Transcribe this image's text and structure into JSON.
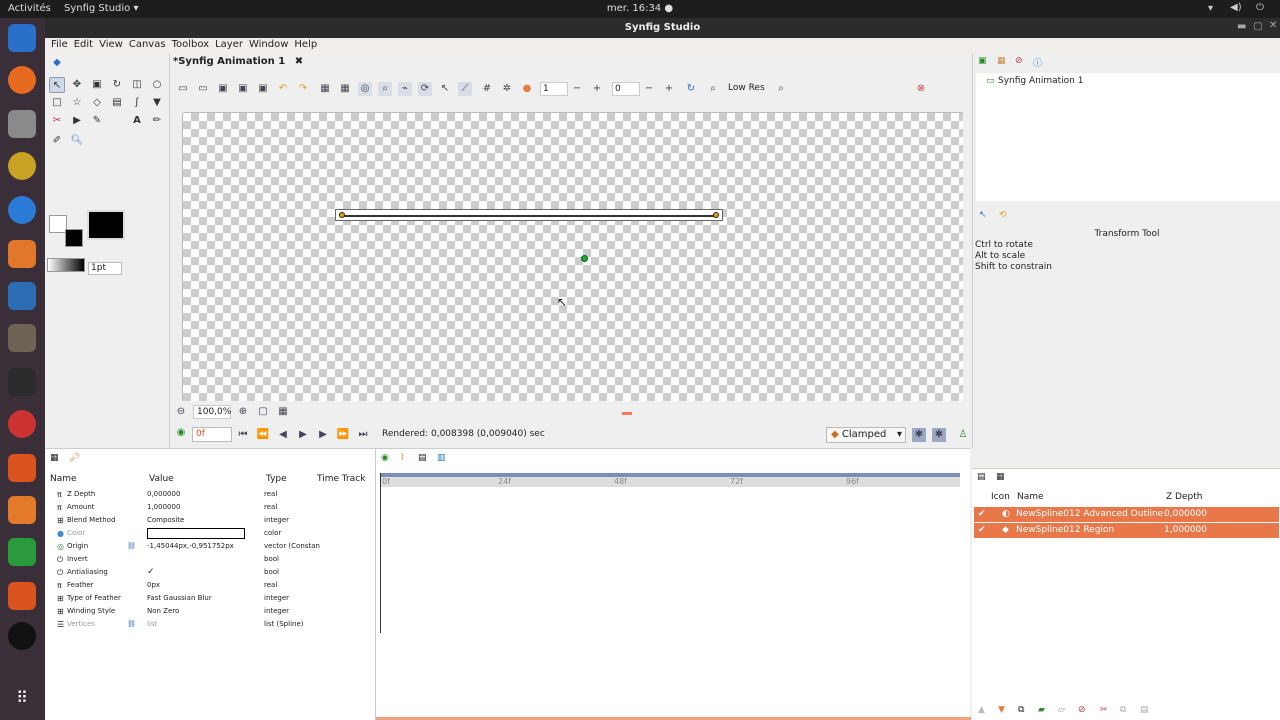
{
  "system": {
    "activities": "Activités",
    "app_menu": "Synfig Studio ▾",
    "clock": "mer. 16:34 ●"
  },
  "window": {
    "title": "Synfig Studio"
  },
  "menu": [
    "File",
    "Edit",
    "View",
    "Canvas",
    "Toolbox",
    "Layer",
    "Window",
    "Help"
  ],
  "toolbox": {
    "width_value": "1pt"
  },
  "document": {
    "tab_label": "*Synfig Animation 1",
    "close_glyph": "✖"
  },
  "canvas_toolbar": {
    "frame_value": "1",
    "frame_value2": "0",
    "low_res": "Low Res"
  },
  "zoom": {
    "value": "100,0%"
  },
  "framebar": {
    "current_frame": "0f",
    "rendered_text": "Rendered: 0,008398 (0,009040) sec",
    "interpolation": "Clamped"
  },
  "canvas_browser": {
    "root": "Synfig Animation 1"
  },
  "tool_options": {
    "title": "Transform Tool",
    "hint1": "Ctrl to rotate",
    "hint2": "Alt to scale",
    "hint3": "Shift to constrain"
  },
  "params": {
    "headers": {
      "name": "Name",
      "value": "Value",
      "type": "Type",
      "timetrack": "Time Track"
    },
    "rows": [
      {
        "name": "Z Depth",
        "value": "0,000000",
        "type": "real"
      },
      {
        "name": "Amount",
        "value": "1,000000",
        "type": "real"
      },
      {
        "name": "Blend Method",
        "value": "Composite",
        "type": "integer"
      },
      {
        "name": "Color",
        "value": "",
        "type": "color"
      },
      {
        "name": "Origin",
        "value": "-1,45044px,-0,951752px",
        "type": "vector (Constan"
      },
      {
        "name": "Invert",
        "value": "",
        "type": "bool"
      },
      {
        "name": "Antialiasing",
        "value": "✓",
        "type": "bool"
      },
      {
        "name": "Feather",
        "value": "0px",
        "type": "real"
      },
      {
        "name": "Type of Feather",
        "value": "Fast Gaussian Blur",
        "type": "integer"
      },
      {
        "name": "Winding Style",
        "value": "Non Zero",
        "type": "integer"
      },
      {
        "name": "Vertices",
        "value": "list",
        "type": "list (Spline)"
      }
    ]
  },
  "timeline": {
    "ticks": [
      "0f",
      "24f",
      "48f",
      "72f",
      "96f"
    ]
  },
  "layers": {
    "headers": {
      "icon": "Icon",
      "name": "Name",
      "zdepth": "Z Depth"
    },
    "rows": [
      {
        "name": "NewSpline012 Advanced Outline",
        "zdepth": "0,000000"
      },
      {
        "name": "NewSpline012 Region",
        "zdepth": "1,000000"
      }
    ]
  },
  "colors": {
    "accent": "#e8784a",
    "dock": "#3a2f38"
  }
}
